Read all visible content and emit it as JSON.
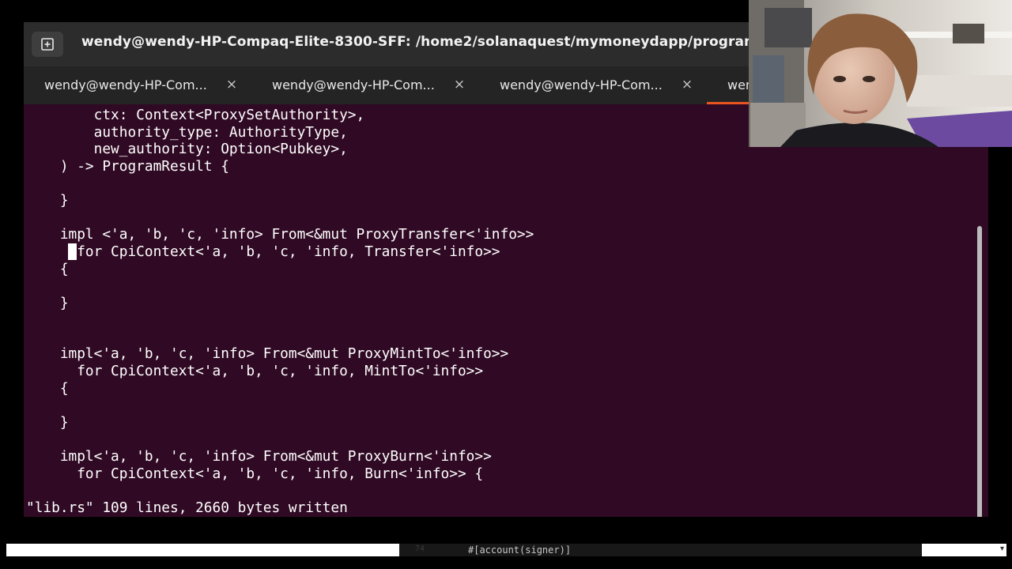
{
  "window": {
    "title": "wendy@wendy-HP-Compaq-Elite-8300-SFF: /home2/solanaquest/mymoneydapp/programs/mymoney"
  },
  "tabs": [
    {
      "label": "wendy@wendy-HP-Com...",
      "close": "×"
    },
    {
      "label": "wendy@wendy-HP-Com...",
      "close": "×"
    },
    {
      "label": "wendy@wendy-HP-Com...",
      "close": "×"
    },
    {
      "label": "wen",
      "close": ""
    }
  ],
  "terminal": {
    "lines": [
      "        ctx: Context<ProxySetAuthority>,",
      "        authority_type: AuthorityType,",
      "        new_authority: Option<Pubkey>,",
      "    ) -> ProgramResult {",
      "",
      "    }",
      "",
      "    impl <'a, 'b, 'c, 'info> From<&mut ProxyTransfer<'info>>",
      "      for CpiContext<'a, 'b, 'c, 'info, Transfer<'info>>",
      "    {",
      "",
      "    }",
      "",
      "",
      "    impl<'a, 'b, 'c, 'info> From<&mut ProxyMintTo<'info>>",
      "      for CpiContext<'a, 'b, 'c, 'info, MintTo<'info>>",
      "    {",
      "",
      "    }",
      "",
      "    impl<'a, 'b, 'c, 'info> From<&mut ProxyBurn<'info>>",
      "      for CpiContext<'a, 'b, 'c, 'info, Burn<'info>> {",
      "",
      "\"lib.rs\" 109 lines, 2660 bytes written"
    ]
  },
  "taskbar": {
    "line_number": "74",
    "text": "#[account(signer)]",
    "arrow": "▾"
  },
  "colors": {
    "terminal_bg": "#300a24",
    "titlebar_bg": "#2c2c2c",
    "tab_accent": "#e95420"
  }
}
